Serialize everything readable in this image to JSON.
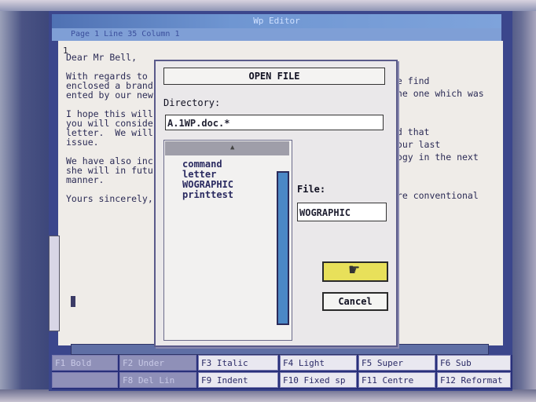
{
  "window": {
    "title": "Wp Editor",
    "status": "Page 1 Line 35 Column 1"
  },
  "document": {
    "ruler_marker": "1",
    "lines_left": [
      "Dear Mr Bell,",
      "",
      "With regards to",
      "enclosed a brand",
      "ented by our new",
      "",
      "I hope this will",
      "you will conside",
      "letter.  We will",
      "issue.",
      "",
      "We have also inc",
      "she will in futu",
      "manner.",
      "",
      "Yours sincerely,"
    ],
    "lines_right": [
      "se find",
      "the one which was",
      "",
      "",
      "nd that",
      "your last",
      "logy in the next",
      "",
      "",
      "ore conventional"
    ]
  },
  "dialog": {
    "title": "OPEN FILE",
    "directory_label": "Directory:",
    "directory_value": "A.1WP.doc.*",
    "files": [
      "command",
      "letter",
      "WOGRAPHIC",
      "printtest"
    ],
    "file_label": "File:",
    "file_value": "WOGRAPHIC",
    "cancel_label": "Cancel"
  },
  "function_keys": {
    "row1": [
      "F1  Bold",
      "F2  Under",
      "F3  Italic",
      "F4  Light",
      "F5  Super",
      "F6  Sub"
    ],
    "row2": [
      "",
      "F8  Del Lin",
      "F9  Indent",
      "F10 Fixed sp",
      "F11 Centre",
      "F12 Reformat"
    ]
  },
  "colors": {
    "accent": "#4b88c6",
    "ok_button": "#e8e05a",
    "screen_blue": "#3b468c"
  }
}
